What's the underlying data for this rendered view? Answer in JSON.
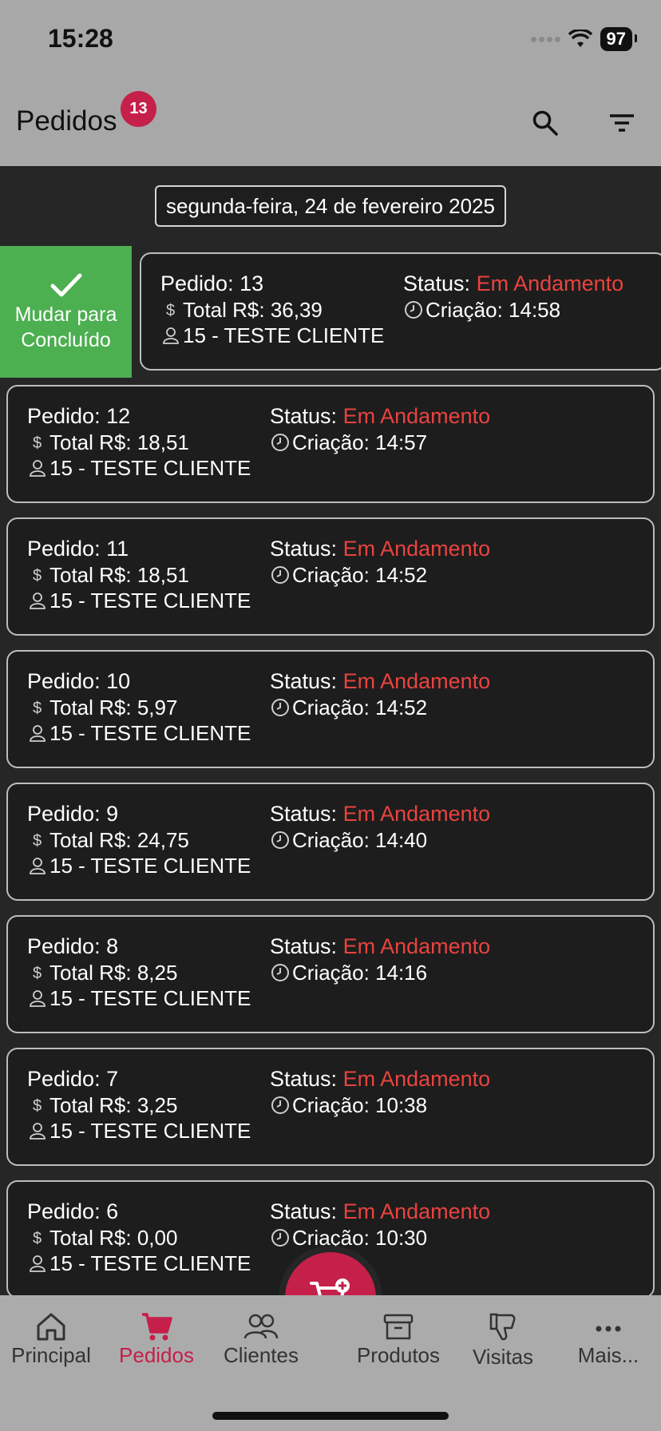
{
  "status_bar": {
    "time": "15:28",
    "battery": "97"
  },
  "app_bar": {
    "title": "Pedidos",
    "badge_count": "13",
    "search_icon": "search-icon",
    "filter_icon": "filter-icon"
  },
  "date_filter": {
    "label": "segunda-feira, 24 de fevereiro 2025"
  },
  "swipe_action": {
    "label_line1": "Mudar para",
    "label_line2": "Concluído",
    "color": "#4caf50"
  },
  "colors": {
    "accent": "#c4204a",
    "status": "#e9433f",
    "success": "#4caf50"
  },
  "orders": [
    {
      "pedido": "Pedido: 13",
      "total": "Total R$: 36,39",
      "cliente": "15 - TESTE CLIENTE",
      "status_label": "Status:",
      "status": "Em Andamento",
      "criacao": "Criação: 14:58"
    },
    {
      "pedido": "Pedido: 12",
      "total": "Total R$: 18,51",
      "cliente": "15 - TESTE CLIENTE",
      "status_label": "Status:",
      "status": "Em Andamento",
      "criacao": "Criação: 14:57"
    },
    {
      "pedido": "Pedido: 11",
      "total": "Total R$: 18,51",
      "cliente": "15 - TESTE CLIENTE",
      "status_label": "Status:",
      "status": "Em Andamento",
      "criacao": "Criação: 14:52"
    },
    {
      "pedido": "Pedido: 10",
      "total": "Total R$: 5,97",
      "cliente": "15 - TESTE CLIENTE",
      "status_label": "Status:",
      "status": "Em Andamento",
      "criacao": "Criação: 14:52"
    },
    {
      "pedido": "Pedido: 9",
      "total": "Total R$: 24,75",
      "cliente": "15 - TESTE CLIENTE",
      "status_label": "Status:",
      "status": "Em Andamento",
      "criacao": "Criação: 14:40"
    },
    {
      "pedido": "Pedido: 8",
      "total": "Total R$: 8,25",
      "cliente": "15 - TESTE CLIENTE",
      "status_label": "Status:",
      "status": "Em Andamento",
      "criacao": "Criação: 14:16"
    },
    {
      "pedido": "Pedido: 7",
      "total": "Total R$: 3,25",
      "cliente": "15 - TESTE CLIENTE",
      "status_label": "Status:",
      "status": "Em Andamento",
      "criacao": "Criação: 10:38"
    },
    {
      "pedido": "Pedido: 6",
      "total": "Total R$: 0,00",
      "cliente": "15 - TESTE CLIENTE",
      "status_label": "Status:",
      "status": "Em Andamento",
      "criacao": "Criação: 10:30"
    }
  ],
  "fab": {
    "icon": "cart-add-icon"
  },
  "bottom_nav": [
    {
      "label": "Principal",
      "icon": "home-icon"
    },
    {
      "label": "Pedidos",
      "icon": "cart-icon",
      "active": true
    },
    {
      "label": "Clientes",
      "icon": "users-icon"
    },
    {
      "label": "Produtos",
      "icon": "archive-icon"
    },
    {
      "label": "Visitas",
      "icon": "thumb-down-icon"
    },
    {
      "label": "Mais...",
      "icon": "more-icon"
    }
  ]
}
